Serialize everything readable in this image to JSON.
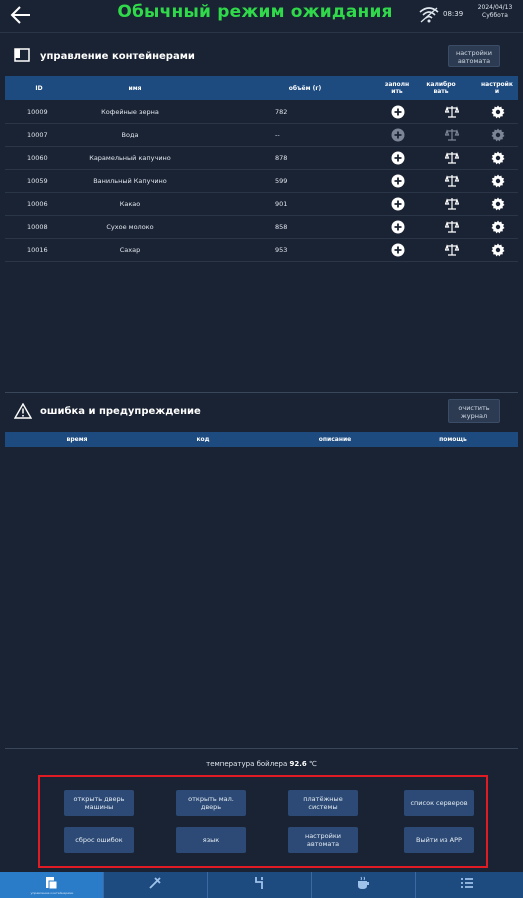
{
  "header": {
    "title": "Обычный режим ожидания",
    "time": "08:39",
    "date": "2024/04/13",
    "weekday": "Суббота"
  },
  "containers": {
    "title": "управление контейнерами",
    "settings_button": "настройки автомата",
    "columns": {
      "id": "ID",
      "name": "имя",
      "volume": "объём (г)",
      "fill": "заполнить",
      "calibrate": "калибровать",
      "settings": "настройки"
    },
    "rows": [
      {
        "id": "10009",
        "name": "Кофейные зерна",
        "volume": "782",
        "enabled": true
      },
      {
        "id": "10007",
        "name": "Вода",
        "volume": "--",
        "enabled": false
      },
      {
        "id": "10060",
        "name": "Карамельный капучино",
        "volume": "878",
        "enabled": true
      },
      {
        "id": "10059",
        "name": "Ванильный Капучино",
        "volume": "599",
        "enabled": true
      },
      {
        "id": "10006",
        "name": "Какао",
        "volume": "901",
        "enabled": true
      },
      {
        "id": "10008",
        "name": "Сухое молоко",
        "volume": "858",
        "enabled": true
      },
      {
        "id": "10016",
        "name": "Сахар",
        "volume": "953",
        "enabled": true
      }
    ]
  },
  "errors": {
    "title": "ошибка и предупреждение",
    "clear_button": "очистить журнал",
    "columns": {
      "time": "время",
      "code": "код",
      "description": "описание",
      "help": "помощь"
    }
  },
  "boiler": {
    "label": "температура бойлера",
    "value": "92.6",
    "unit": "℃"
  },
  "actions": {
    "open_machine_door": "открыть дверь машины",
    "open_small_door": "открыть мал. дверь",
    "payment_systems": "платёжные системы",
    "server_list": "список серверов",
    "reset_errors": "сброс ошибок",
    "language": "язык",
    "machine_settings": "настройки автомата",
    "exit_app": "Выйти из APP"
  },
  "nav": {
    "items": [
      {
        "label": "управление контейнерами",
        "icon": "container-icon",
        "active": true
      },
      {
        "label": "",
        "icon": "tools-icon",
        "active": false
      },
      {
        "label": "",
        "icon": "pipes-icon",
        "active": false
      },
      {
        "label": "",
        "icon": "cup-icon",
        "active": false
      },
      {
        "label": "",
        "icon": "list-icon",
        "active": false
      }
    ]
  },
  "colors": {
    "background": "#1a2333",
    "title_green": "#2fd94a",
    "header_blue": "#1d4b80",
    "active_tab": "#2b7cc8",
    "highlight_red": "#e01b24"
  }
}
